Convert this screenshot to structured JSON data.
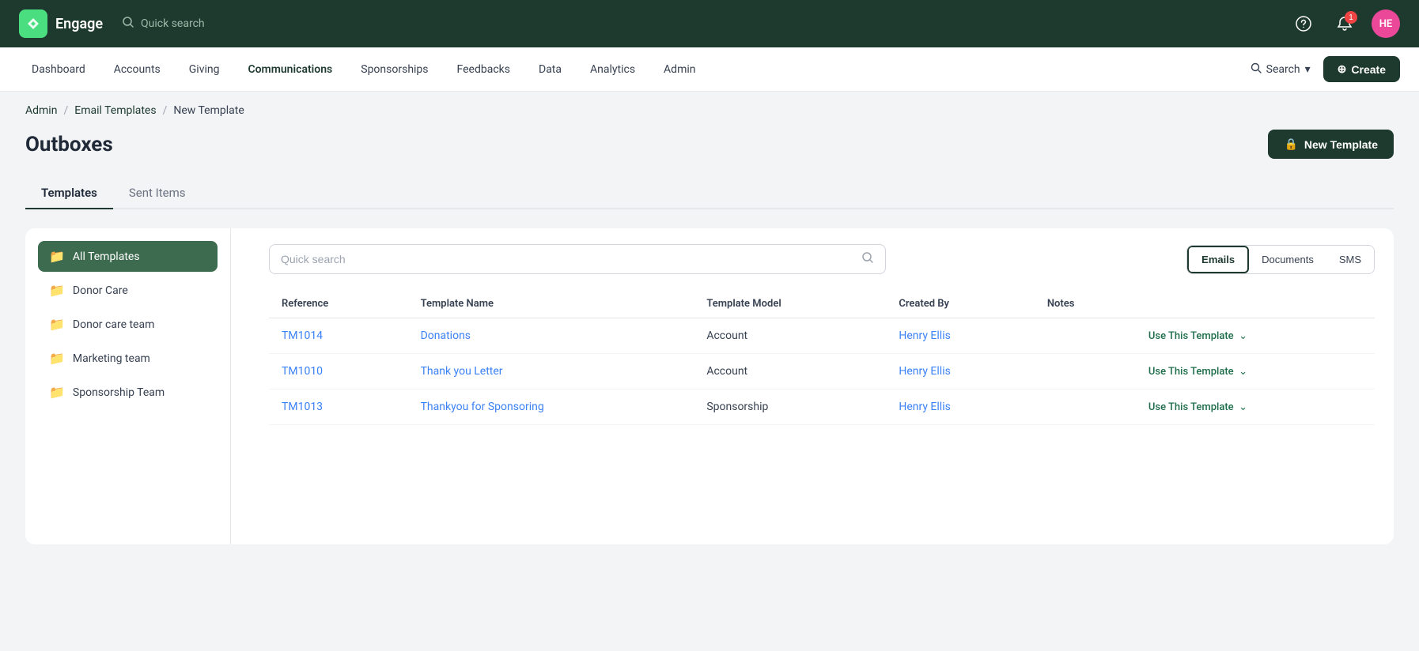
{
  "app": {
    "name": "Engage",
    "logo_text": "🔷"
  },
  "topbar": {
    "search_placeholder": "Quick search",
    "notification_count": "1",
    "avatar_initials": "HE"
  },
  "navbar": {
    "items": [
      {
        "label": "Dashboard",
        "active": false
      },
      {
        "label": "Accounts",
        "active": false
      },
      {
        "label": "Giving",
        "active": false
      },
      {
        "label": "Communications",
        "active": true
      },
      {
        "label": "Sponsorships",
        "active": false
      },
      {
        "label": "Feedbacks",
        "active": false
      },
      {
        "label": "Data",
        "active": false
      },
      {
        "label": "Analytics",
        "active": false
      },
      {
        "label": "Admin",
        "active": false
      }
    ],
    "search_label": "Search",
    "create_label": "Create"
  },
  "breadcrumb": {
    "items": [
      {
        "label": "Admin",
        "link": true
      },
      {
        "label": "Email Templates",
        "link": true
      },
      {
        "label": "New Template",
        "link": false
      }
    ]
  },
  "page": {
    "title": "Outboxes",
    "new_template_btn": "New Template"
  },
  "tabs": [
    {
      "label": "Templates",
      "active": true
    },
    {
      "label": "Sent Items",
      "active": false
    }
  ],
  "sidebar": {
    "items": [
      {
        "label": "All Templates",
        "active": true,
        "icon": "📁"
      },
      {
        "label": "Donor Care",
        "active": false,
        "icon": "📁"
      },
      {
        "label": "Donor care team",
        "active": false,
        "icon": "📁"
      },
      {
        "label": "Marketing team",
        "active": false,
        "icon": "📁"
      },
      {
        "label": "Sponsorship Team",
        "active": false,
        "icon": "📁"
      }
    ]
  },
  "panel": {
    "search_placeholder": "Quick search",
    "type_filters": [
      {
        "label": "Emails",
        "active": true
      },
      {
        "label": "Documents",
        "active": false
      },
      {
        "label": "SMS",
        "active": false
      }
    ],
    "table": {
      "headers": [
        "Reference",
        "Template Name",
        "Template Model",
        "Created By",
        "Notes"
      ],
      "rows": [
        {
          "reference": "TM1014",
          "template_name": "Donations",
          "template_model": "Account",
          "created_by": "Henry Ellis",
          "action": "Use This Template"
        },
        {
          "reference": "TM1010",
          "template_name": "Thank you Letter",
          "template_model": "Account",
          "created_by": "Henry Ellis",
          "action": "Use This Template"
        },
        {
          "reference": "TM1013",
          "template_name": "Thankyou for Sponsoring",
          "template_model": "Sponsorship",
          "created_by": "Henry Ellis",
          "action": "Use This Template"
        }
      ]
    }
  }
}
